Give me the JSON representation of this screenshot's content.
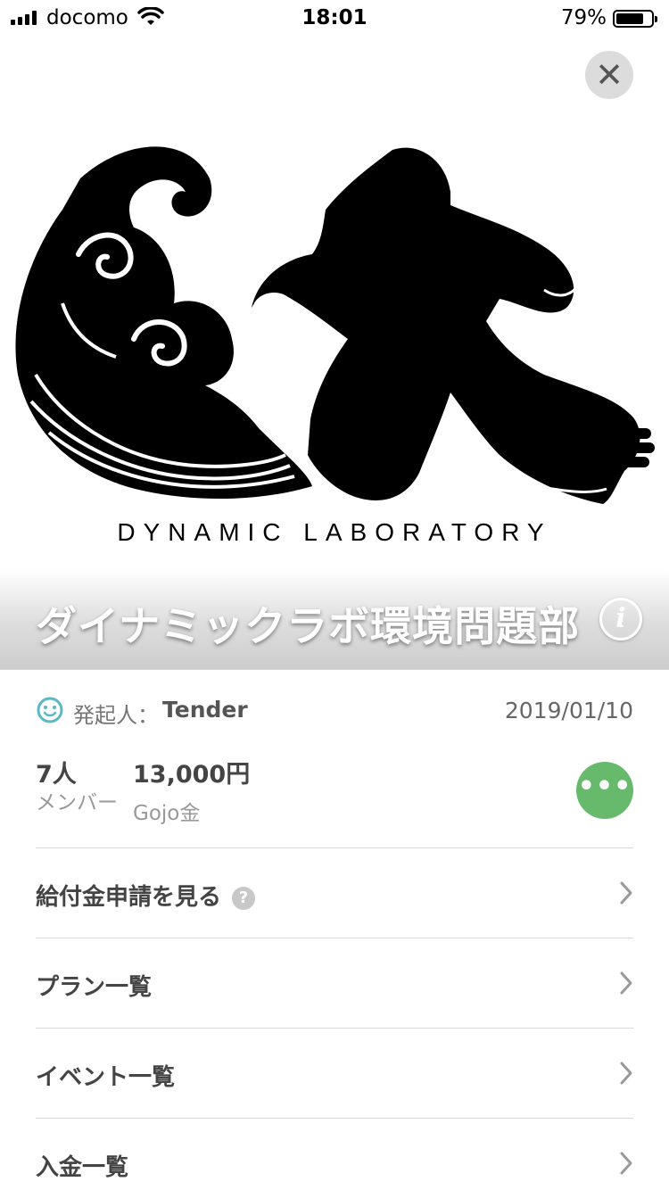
{
  "status_bar": {
    "carrier": "docomo",
    "time": "18:01",
    "battery_percent": "79%",
    "battery_level": 0.79
  },
  "hero": {
    "logo_text": "DYNAMIC LABORATORY",
    "group_name": "ダイナミックラボ環境問題部",
    "info_icon_glyph": "i",
    "close_icon_glyph": "✕"
  },
  "founder": {
    "label": "発起人：",
    "name": "Tender",
    "date": "2019/01/10"
  },
  "stats": {
    "members_value": "7人",
    "members_label": "メンバー",
    "gojo_value": "13,000円",
    "gojo_label": "Gojo金",
    "more_glyph": "•••"
  },
  "menu": {
    "items": [
      {
        "label": "給付金申請を見る",
        "help": "?"
      },
      {
        "label": "プラン一覧"
      },
      {
        "label": "イベント一覧"
      },
      {
        "label": "入金一覧"
      }
    ]
  },
  "colors": {
    "accent_green": "#67b96c",
    "teal_icon": "#5bb8c4"
  }
}
